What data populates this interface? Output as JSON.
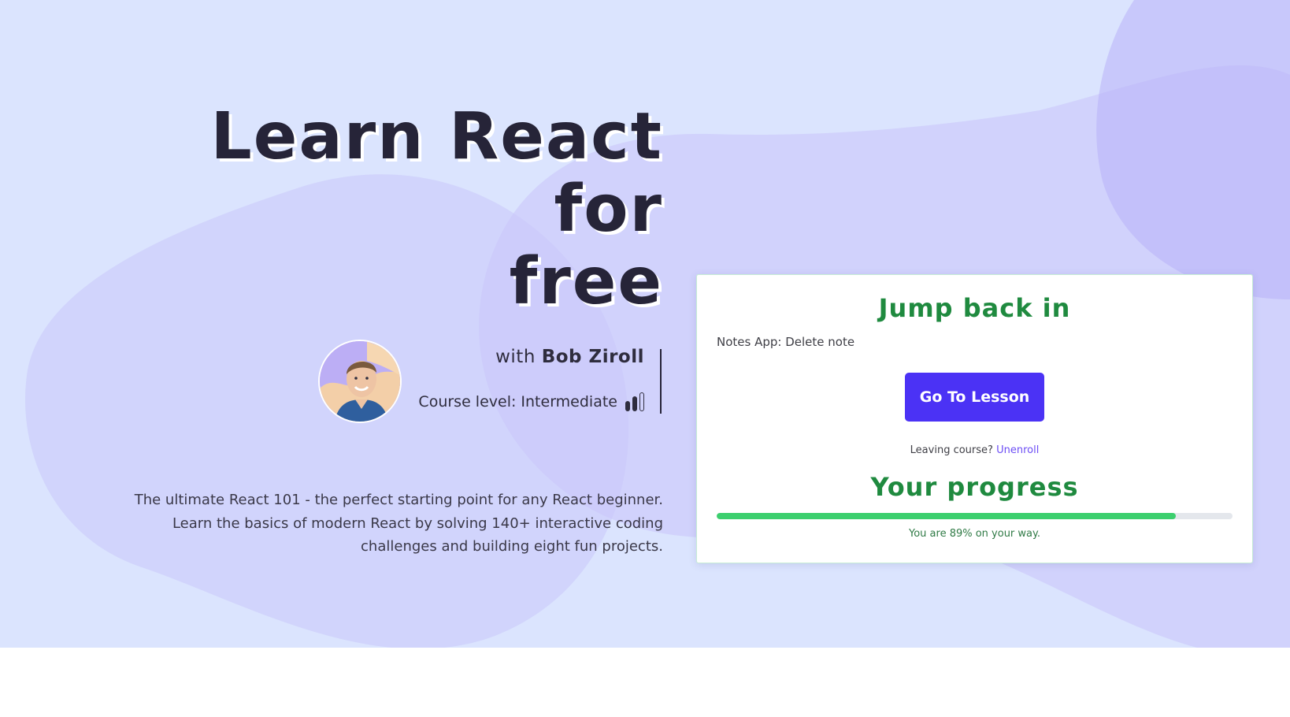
{
  "hero": {
    "title_line1": "Learn React for",
    "title_line2": "free",
    "instructor_prefix": "with",
    "instructor_name": "Bob Ziroll",
    "course_level_label": "Course level: Intermediate",
    "course_level_icon": "signal-bars-icon",
    "course_level_value": 2,
    "course_level_max": 3,
    "description_lines": [
      "The ultimate React 101 - the perfect starting point for any React beginner.",
      "Learn the basics of modern React by solving 140+ interactive coding",
      "challenges and building eight fun projects."
    ]
  },
  "card": {
    "heading": "Jump back in",
    "lesson_name": "Notes App: Delete note",
    "button_label": "Go To Lesson",
    "leaving_text": "Leaving course?",
    "unenroll_label": "Unenroll",
    "progress_heading": "Your progress",
    "progress_fraction": 0.89,
    "progress_text": "You are 89% on your way."
  },
  "colors": {
    "hero_background": "#dbe4fe",
    "blob": "#c9c6fa",
    "title": "#262438",
    "accent_green": "#1f8a3f",
    "progress_fill": "#3ccf6e",
    "button": "#4b32f5",
    "link": "#6c4df5"
  }
}
